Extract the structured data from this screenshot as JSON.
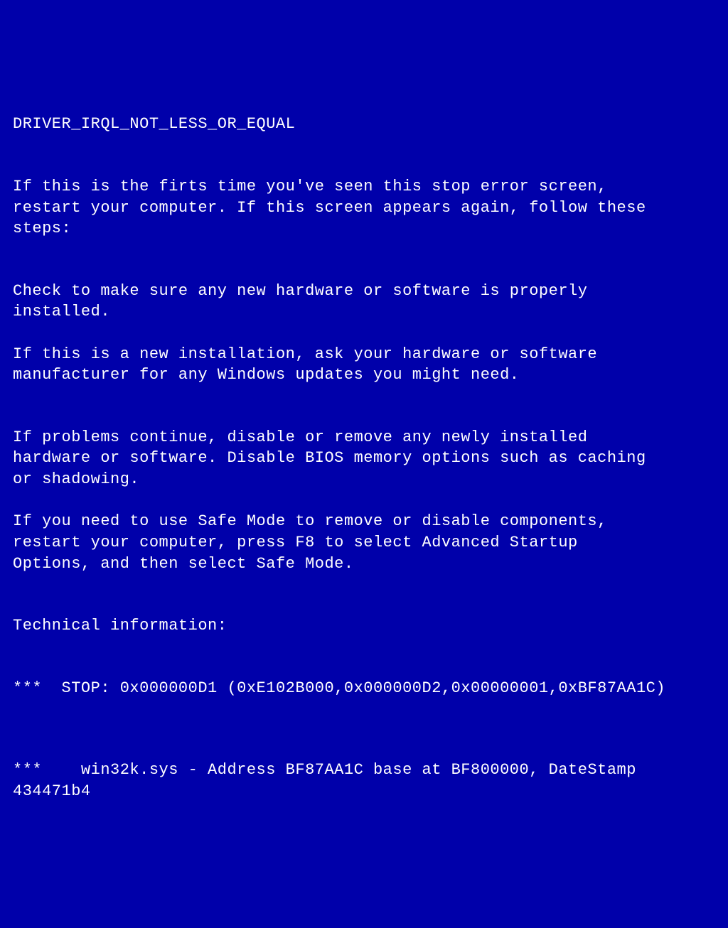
{
  "bsod": {
    "error_name": "DRIVER_IRQL_NOT_LESS_OR_EQUAL",
    "intro": "If this is the firts time you've seen this stop error screen,\nrestart your computer. If this screen appears again, follow these\nsteps:",
    "check_hw": "Check to make sure any new hardware or software is properly\ninstalled.",
    "new_install": "If this is a new installation, ask your hardware or software\nmanufacturer for any Windows updates you might need.",
    "problems_continue": "If problems continue, disable or remove any newly installed\nhardware or software. Disable BIOS memory options such as caching\nor shadowing.",
    "safe_mode": "If you need to use Safe Mode to remove or disable components,\nrestart your computer, press F8 to select Advanced Startup\nOptions, and then select Safe Mode.",
    "tech_info_label": "Technical information:",
    "stop_line": "***  STOP: 0x000000D1 (0xE102B000,0x000000D2,0x00000001,0xBF87AA1C)",
    "module_line": "***    win32k.sys - Address BF87AA1C base at BF800000, DateStamp\n434471b4",
    "stop_code": "0x000000D1",
    "stop_params": [
      "0xE102B000",
      "0x000000D2",
      "0x00000001",
      "0xBF87AA1C"
    ],
    "module": "win32k.sys",
    "module_address": "BF87AA1C",
    "module_base": "BF800000",
    "module_datestamp": "434471b4",
    "colors": {
      "background": "#0000AA",
      "foreground": "#FFFFFF"
    }
  }
}
